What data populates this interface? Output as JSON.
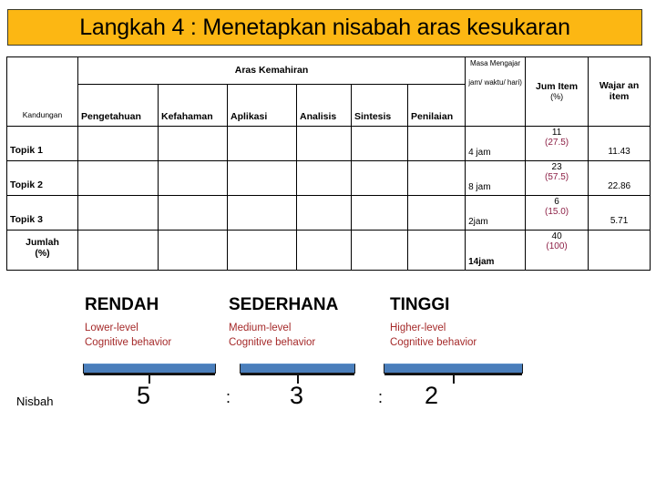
{
  "title": {
    "text": "Langkah 4 : Menetapkan nisabah aras kesukaran",
    "bg_color": "#FCB713"
  },
  "table": {
    "group_header": "Aras Kemahiran",
    "col_kandungan": "Kandungan",
    "col_masa_mengajar": "Masa Mengajar",
    "col_masa_mengajar_sub": "jam/ waktu/ hari)",
    "col_jum_item": "Jum Item",
    "col_jum_item_pct": "(%)",
    "col_wajaran_item": "Wajar an item",
    "skill_columns": [
      "Pengetahuan",
      "Kefahaman",
      "Aplikasi",
      "Analisis",
      "Sintesis",
      "Penilaian"
    ],
    "rows": [
      {
        "label": "Topik 1",
        "skills": [
          "",
          "",
          "",
          "",
          "",
          ""
        ],
        "masa": "4 jam",
        "jum_item": "11",
        "jum_item_pct": "(27.5)",
        "wajaran": "11.43"
      },
      {
        "label": "Topik 2",
        "skills": [
          "",
          "",
          "",
          "",
          "",
          ""
        ],
        "masa": "8 jam",
        "jum_item": "23",
        "jum_item_pct": "(57.5)",
        "wajaran": "22.86"
      },
      {
        "label": "Topik 3",
        "skills": [
          "",
          "",
          "",
          "",
          "",
          ""
        ],
        "masa": "2jam",
        "jum_item": "6",
        "jum_item_pct": "(15.0)",
        "wajaran": "5.71"
      }
    ],
    "total_row": {
      "label_line1": "Jumlah",
      "label_line2": "(%)",
      "skills": [
        "",
        "",
        "",
        "",
        "",
        ""
      ],
      "masa": "14jam",
      "jum_item": "40",
      "jum_item_pct": "(100)",
      "wajaran": ""
    }
  },
  "levels": [
    {
      "title": "RENDAH",
      "desc_line1": "Lower-level",
      "desc_line2": "Cognitive behavior"
    },
    {
      "title": "SEDERHANA",
      "desc_line1": "Medium-level",
      "desc_line2": "Cognitive behavior"
    },
    {
      "title": "TINGGI",
      "desc_line1": "Higher-level",
      "desc_line2": "Cognitive behavior"
    }
  ],
  "nisbah": {
    "label": "Nisbah",
    "value_1": "5",
    "sep_1": ":",
    "value_2": "3",
    "sep_2": ":",
    "value_3": "2"
  },
  "colors": {
    "banner": "#FCB713",
    "bracket_blue": "#4A7EBB",
    "desc_red": "#A52A2A",
    "pct_maroon": "#8C1F45"
  }
}
